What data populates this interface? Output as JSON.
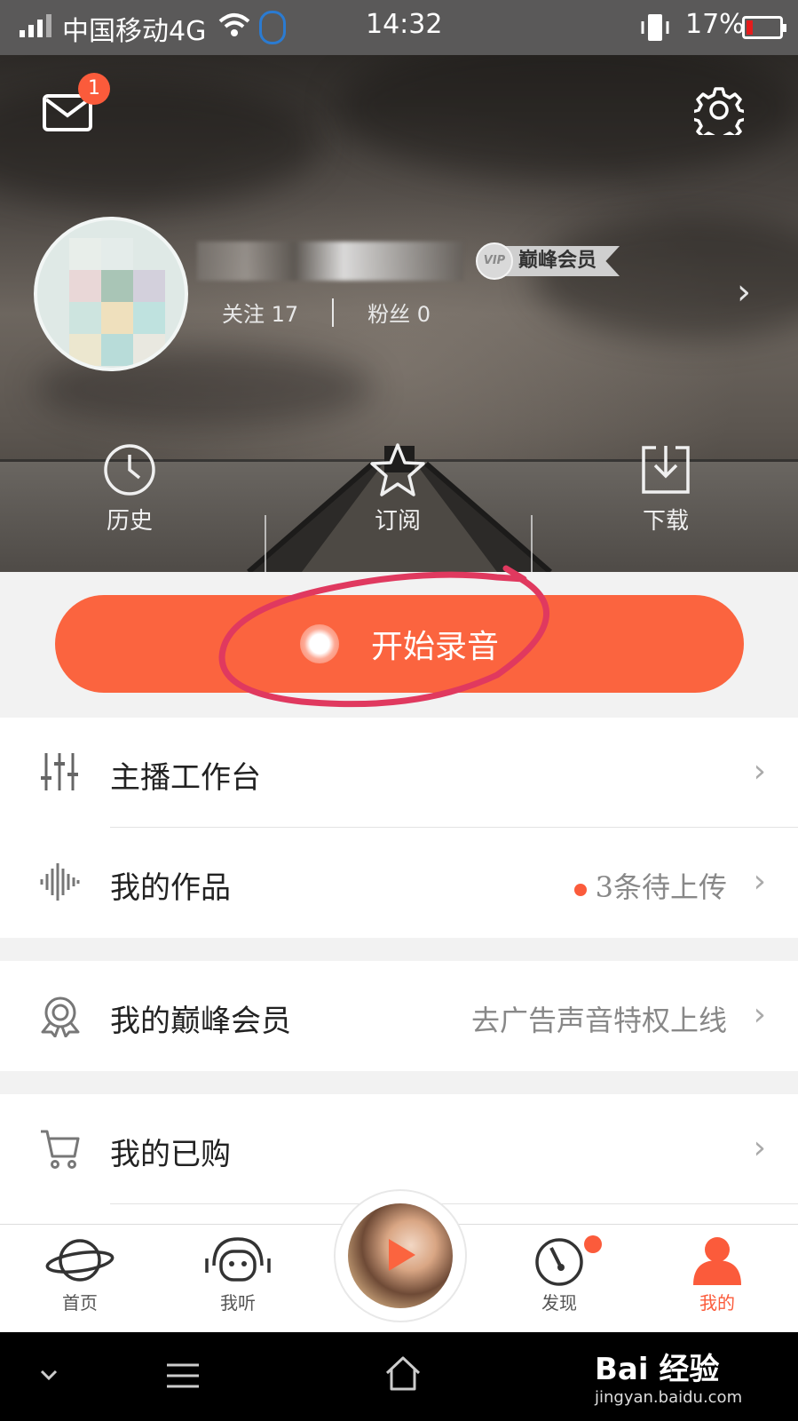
{
  "status_bar": {
    "carrier": "中国移动4G",
    "time": "14:32",
    "battery": "17%"
  },
  "header": {
    "mail_badge": "1",
    "vip_seal": "VIP",
    "vip_label": "巅峰会员",
    "stats": {
      "follow": "关注 17",
      "fans": "粉丝 0"
    },
    "quick": [
      {
        "label": "历史",
        "icon": "clock-icon"
      },
      {
        "label": "订阅",
        "icon": "star-icon"
      },
      {
        "label": "下载",
        "icon": "download-icon"
      }
    ]
  },
  "record": {
    "label": "开始录音"
  },
  "menu": {
    "studio": {
      "label": "主播工作台",
      "icon": "sliders-icon"
    },
    "works": {
      "label": "我的作品",
      "value": "3条待上传",
      "icon": "waveform-icon"
    },
    "vip": {
      "label": "我的巅峰会员",
      "value": "去广告声音特权上线",
      "icon": "medal-icon"
    },
    "purchased": {
      "label": "我的已购",
      "icon": "cart-icon"
    }
  },
  "tabs": [
    {
      "label": "首页",
      "icon": "planet-icon"
    },
    {
      "label": "我听",
      "icon": "headphones-icon"
    },
    {
      "label": "发现",
      "icon": "compass-icon"
    },
    {
      "label": "我的",
      "icon": "person-icon",
      "active": true
    }
  ],
  "watermark": {
    "main": "Bai 经验",
    "sub": "jingyan.baidu.com"
  },
  "colors": {
    "accent": "#fb643f",
    "badge": "#fb5b3b",
    "annotation": "#e0395f"
  }
}
